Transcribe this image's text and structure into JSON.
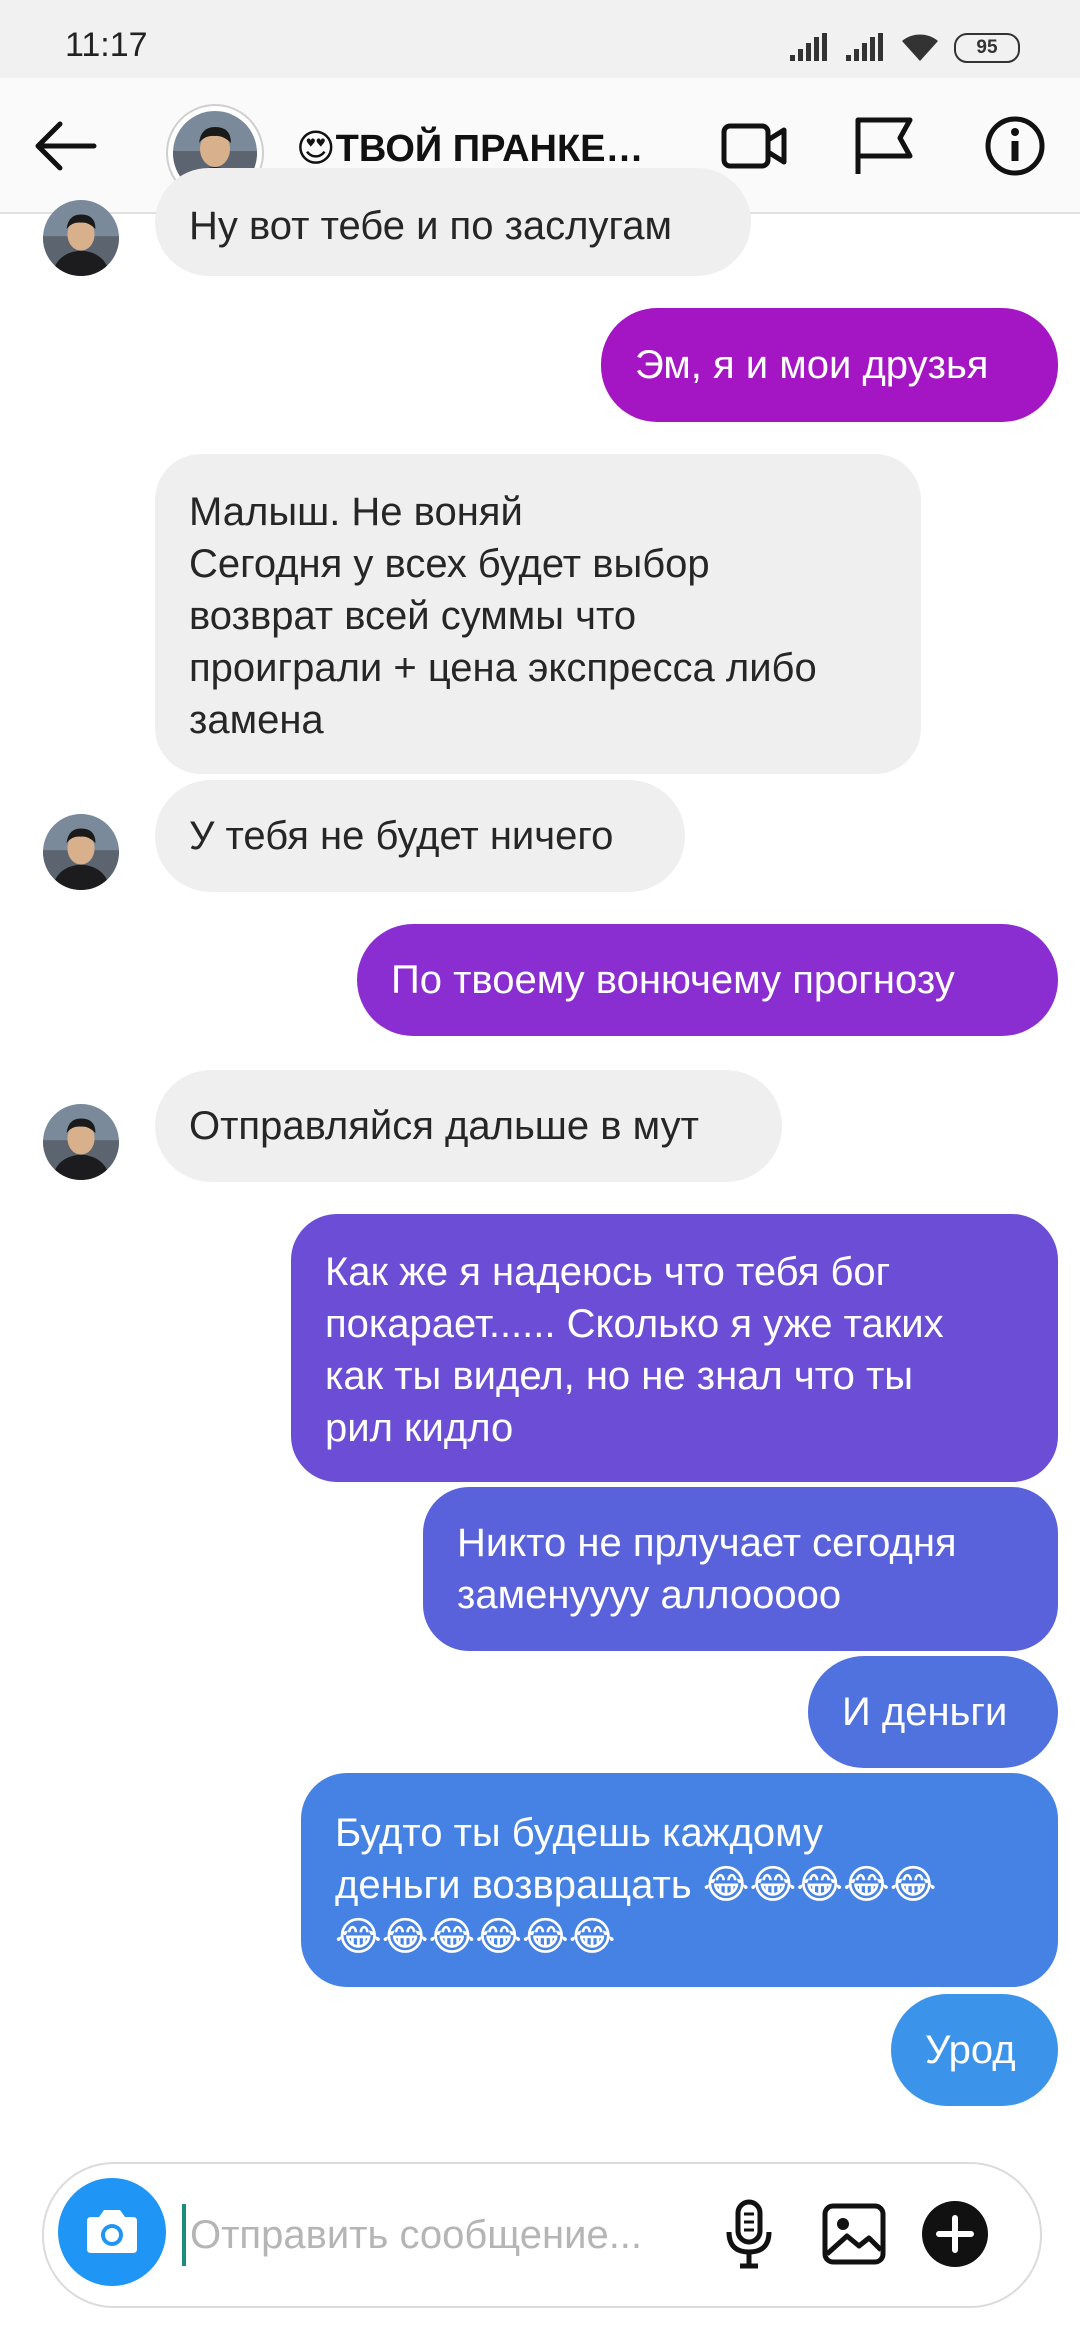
{
  "status_bar": {
    "time": "11:17",
    "battery": "95"
  },
  "header": {
    "title": "😍ТВОЙ ПРАНКЕ…"
  },
  "messages": [
    {
      "side": "in",
      "text": "Ну вот тебе и по заслугам"
    },
    {
      "side": "out",
      "text": "Эм, я и мои друзья"
    },
    {
      "side": "in",
      "text": "Малыш. Не воняй\nСегодня у всех будет выбор\nвозврат всей суммы что\nпроиграли + цена экспресса либо\nзамена"
    },
    {
      "side": "in",
      "text": "У тебя не будет ничего"
    },
    {
      "side": "out",
      "text": "По твоему вонючему прогнозу"
    },
    {
      "side": "in",
      "text": "Отправляйся дальше в мут"
    },
    {
      "side": "out",
      "text": "Как же я надеюсь что тебя бог\nпокарает...... Сколько я уже таких\nкак ты видел, но не знал что ты\nрил кидло"
    },
    {
      "side": "out",
      "text": "Никто не прлучает сегодня\nзаменуууу аллооооо"
    },
    {
      "side": "out",
      "text": "И деньги"
    },
    {
      "side": "out",
      "text": "Будто ты будешь каждому\nденьги возвращать 😂😂😂😂😂\n😂😂😂😂😂😂"
    },
    {
      "side": "out",
      "text": "Урод"
    }
  ],
  "composer": {
    "placeholder": "Отправить сообщение..."
  },
  "colors": {
    "incoming_bubble": "#efefef",
    "outgoing_gradient_top": "#a215c4",
    "outgoing_gradient_bottom": "#3d8fe8",
    "camera_button": "#1f95f5"
  },
  "icons": [
    "back-arrow-icon",
    "video-call-icon",
    "flag-icon",
    "info-icon",
    "camera-icon",
    "microphone-icon",
    "gallery-icon",
    "plus-icon"
  ]
}
